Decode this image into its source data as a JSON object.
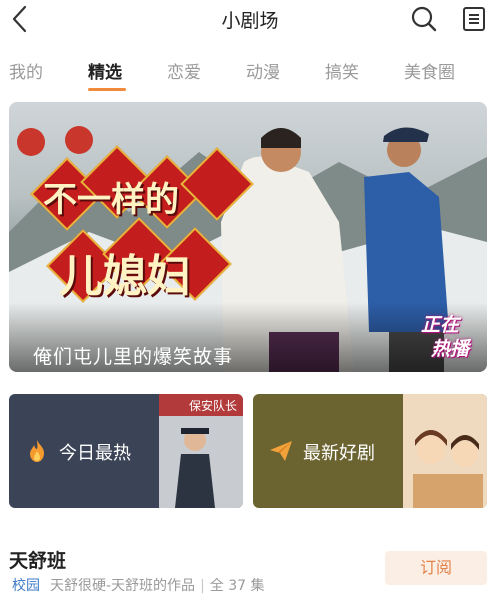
{
  "header": {
    "title": "小剧场",
    "back_icon": "chevron-left-icon",
    "search_icon": "search-icon",
    "list_icon": "list-icon"
  },
  "tabs": [
    {
      "label": "我的",
      "active": false
    },
    {
      "label": "精选",
      "active": true
    },
    {
      "label": "恋爱",
      "active": false
    },
    {
      "label": "动漫",
      "active": false
    },
    {
      "label": "搞笑",
      "active": false
    },
    {
      "label": "美食圈",
      "active": false
    }
  ],
  "banner": {
    "title_line1": "不一样的",
    "title_line2": "儿媳妇",
    "caption": "俺们屯儿里的爆笑故事",
    "badge_line1": "正在",
    "badge_line2": "热播"
  },
  "cards": [
    {
      "label": "今日最热",
      "icon": "flame-icon",
      "photo_text": "保安队长"
    },
    {
      "label": "最新好剧",
      "icon": "paper-plane-icon"
    }
  ],
  "show": {
    "title": "天舒班",
    "category": "校园",
    "description": "天舒很硬-天舒班的作品",
    "separator": "|",
    "episodes": "全 37 集",
    "subscribe_label": "订阅"
  },
  "colors": {
    "accent": "#f28a3c",
    "category_blue": "#3f7bc8",
    "card_hot_bg": "#3b4456",
    "card_new_bg": "#6c6430",
    "subscribe_bg": "#fbeee4",
    "subscribe_text": "#e3834a"
  }
}
